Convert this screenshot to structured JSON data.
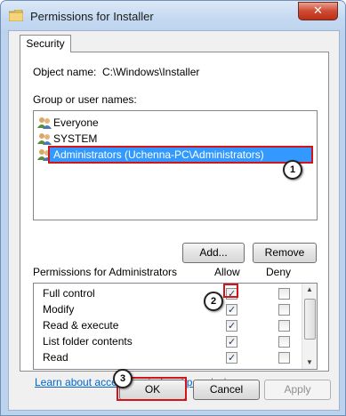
{
  "window": {
    "title": "Permissions for Installer",
    "close_label": "✕"
  },
  "tabs": [
    {
      "label": "Security"
    }
  ],
  "object": {
    "label": "Object name:",
    "value": "C:\\Windows\\Installer"
  },
  "groups": {
    "label": "Group or user names:",
    "items": [
      {
        "label": "Everyone",
        "icon": "users-icon"
      },
      {
        "label": "SYSTEM",
        "icon": "users-icon"
      },
      {
        "label": "Administrators (Uchenna-PC\\Administrators)",
        "icon": "users-icon",
        "selected": true
      }
    ]
  },
  "buttons": {
    "add": "Add...",
    "remove": "Remove",
    "ok": "OK",
    "cancel": "Cancel",
    "apply": "Apply"
  },
  "permissions": {
    "label": "Permissions for Administrators",
    "allow_header": "Allow",
    "deny_header": "Deny",
    "rows": [
      {
        "name": "Full control",
        "allow": true,
        "deny": false
      },
      {
        "name": "Modify",
        "allow": true,
        "deny": false
      },
      {
        "name": "Read & execute",
        "allow": true,
        "deny": false
      },
      {
        "name": "List folder contents",
        "allow": true,
        "deny": false
      },
      {
        "name": "Read",
        "allow": true,
        "deny": false
      }
    ]
  },
  "link": "Learn about access control and permissions",
  "callouts": [
    "1",
    "2",
    "3"
  ],
  "colors": {
    "selection": "#3399ff",
    "highlight": "#d3141b",
    "link": "#0066cc"
  }
}
